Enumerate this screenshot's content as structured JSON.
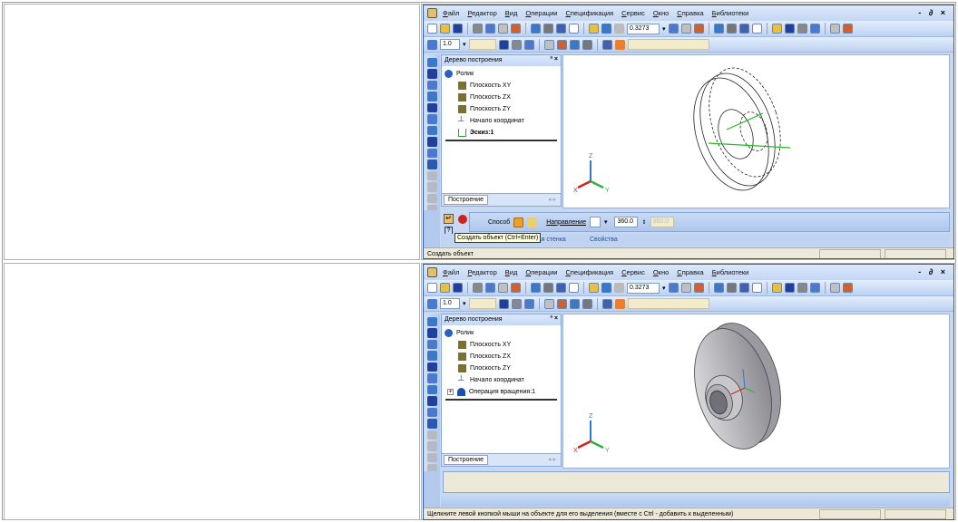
{
  "colors": {
    "accent": "#2a56b8",
    "panel": "#c6d8f2",
    "status": "#ece9d8"
  },
  "windows": [
    {
      "menu": [
        "Файл",
        "Редактор",
        "Вид",
        "Операции",
        "Спецификация",
        "Сервис",
        "Окно",
        "Справка",
        "Библиотеки"
      ],
      "window_controls": "- ∂ ×",
      "zoom_value": "0.3273",
      "scale_value": "1.0",
      "tree": {
        "title": "Дерево построения",
        "close": "ª ×",
        "root": "Ролик",
        "items": [
          "Плоскость XY",
          "Плоскость ZX",
          "Плоскость ZY",
          "Начало координат",
          "Эскиз:1"
        ],
        "tab": "Построение"
      },
      "params": {
        "method_label": "Способ",
        "direction_label": "Направление",
        "angle1": "360.0",
        "angle2": "360.0",
        "tabs": [
          "Тонкая стенка",
          "Свойства"
        ],
        "tooltip": "Создать объект (Ctrl+Enter)"
      },
      "status": "Создать объект",
      "axes": {
        "x": "X",
        "y": "Y",
        "z": "Z"
      }
    },
    {
      "menu": [
        "Файл",
        "Редактор",
        "Вид",
        "Операции",
        "Спецификация",
        "Сервис",
        "Окно",
        "Справка",
        "Библиотеки"
      ],
      "window_controls": "- ∂ ×",
      "zoom_value": "0.3273",
      "scale_value": "1.0",
      "tree": {
        "title": "Дерево построения",
        "close": "ª ×",
        "root": "Ролик",
        "items": [
          "Плоскость XY",
          "Плоскость ZX",
          "Плоскость ZY",
          "Начало координат",
          "Операция вращения:1"
        ],
        "tab": "Построение"
      },
      "status": "Щелкните левой кнопкой мыши на объекте для его выделения (вместе с Ctrl - добавить к выделенным)",
      "axes": {
        "x": "X",
        "y": "Y",
        "z": "Z"
      }
    }
  ]
}
